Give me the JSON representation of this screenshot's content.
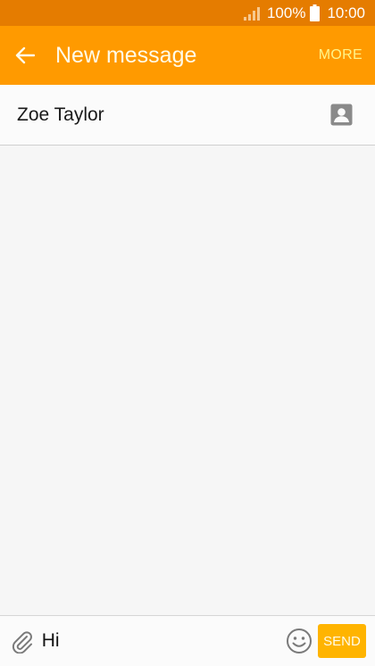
{
  "status_bar": {
    "signal_icon": "signal-icon",
    "battery_percent": "100%",
    "battery_icon": "battery-icon",
    "time": "10:00"
  },
  "app_bar": {
    "back_icon": "arrow-left-icon",
    "title": "New message",
    "more_label": "MORE"
  },
  "recipient": {
    "name": "Zoe Taylor",
    "contact_icon": "contact-icon"
  },
  "composer": {
    "attach_icon": "paperclip-icon",
    "message_value": "Hi",
    "emoji_icon": "smiley-icon",
    "send_label": "SEND"
  },
  "colors": {
    "status_bar_bg": "#e57c00",
    "app_bar_bg": "#ff9a00",
    "more_text": "#fff48a",
    "send_button_bg": "#ffb400",
    "background": "#f6f6f6"
  }
}
